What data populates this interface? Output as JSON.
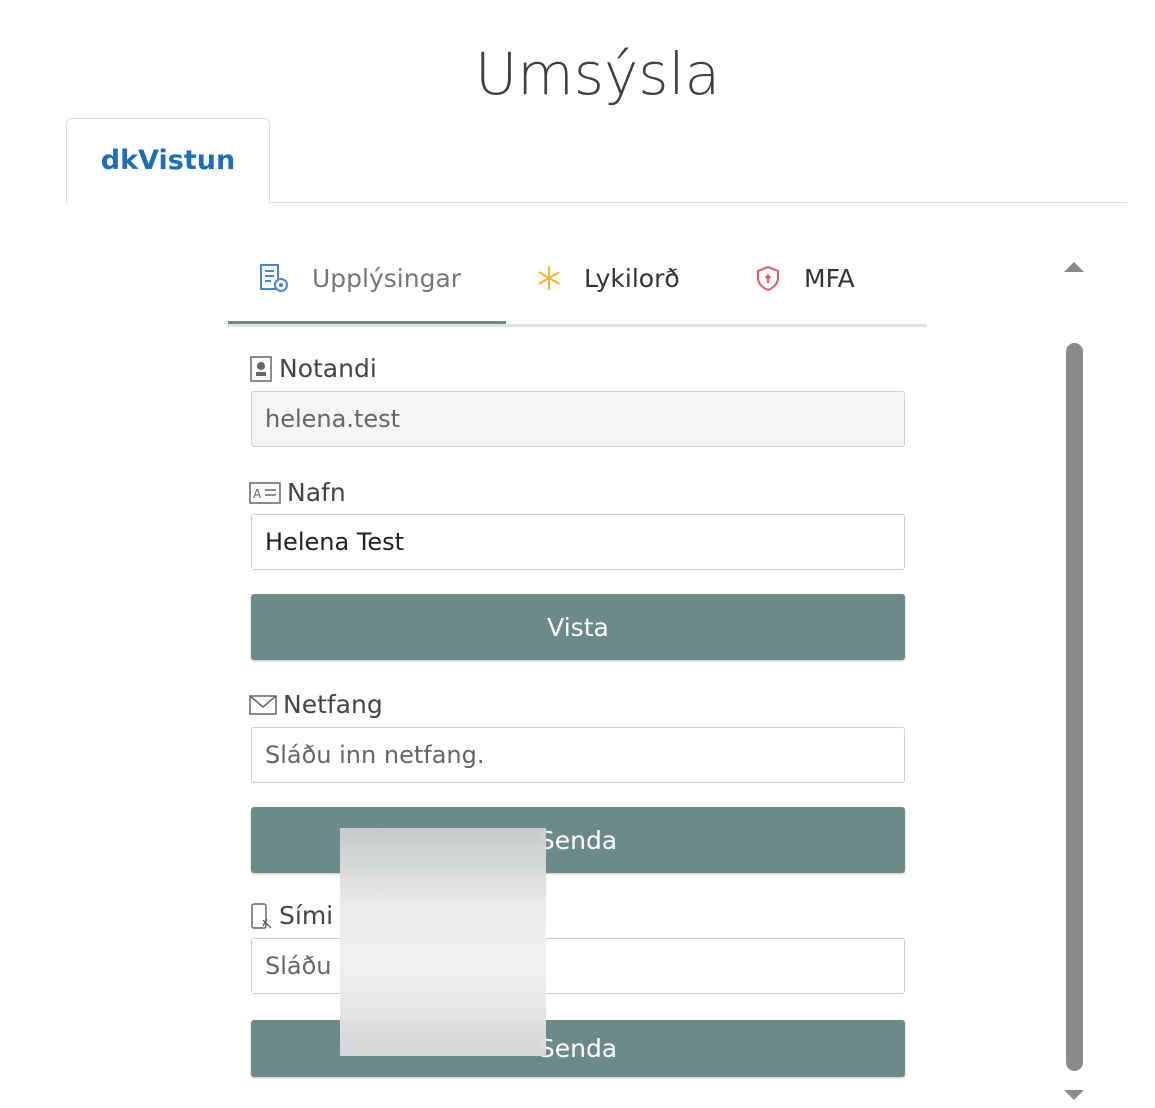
{
  "page": {
    "title": "Umsýsla"
  },
  "top_tabs": [
    {
      "label": "dkVistun"
    }
  ],
  "sub_tabs": [
    {
      "label": "Upplýsingar",
      "icon": "document-settings-icon",
      "active": true
    },
    {
      "label": "Lykilorð",
      "icon": "asterisk-icon",
      "active": false
    },
    {
      "label": "MFA",
      "icon": "shield-icon",
      "active": false
    }
  ],
  "form": {
    "username": {
      "label": "Notandi",
      "value": "helena.test",
      "icon": "user-badge-icon"
    },
    "name": {
      "label": "Nafn",
      "value": "Helena Test",
      "icon": "id-card-icon"
    },
    "save_label": "Vista",
    "email": {
      "label": "Netfang",
      "placeholder": "Sláðu inn netfang.",
      "icon": "envelope-icon"
    },
    "email_send_label": "Senda",
    "phone": {
      "label": "Sími",
      "placeholder": "Sláðu i",
      "icon": "phone-icon"
    },
    "phone_send_label": "Senda"
  },
  "colors": {
    "accent": "#6c8a87",
    "link": "#1f6fb2"
  }
}
